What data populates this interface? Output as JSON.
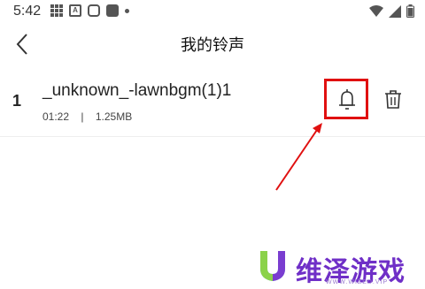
{
  "status_bar": {
    "time": "5:42",
    "icons": [
      "grid-icon",
      "a-icon",
      "app-icon",
      "app-square-icon",
      "dot-icon"
    ],
    "right_icons": [
      "wifi-icon",
      "signal-icon",
      "battery-icon"
    ]
  },
  "header": {
    "back_icon": "back-arrow-icon",
    "title": "我的铃声"
  },
  "ringtones": [
    {
      "index": "1",
      "title": "_unknown_-lawnbgm(1)1",
      "duration": "01:22",
      "separator": "|",
      "size": "1.25MB",
      "actions": [
        "bell-icon",
        "trash-icon"
      ]
    }
  ],
  "annotation": {
    "color": "#e01010"
  },
  "watermark": {
    "text": "维泽游戏",
    "subtext": "WWW.WIZED.VIP",
    "color": "#6f2fc7"
  }
}
